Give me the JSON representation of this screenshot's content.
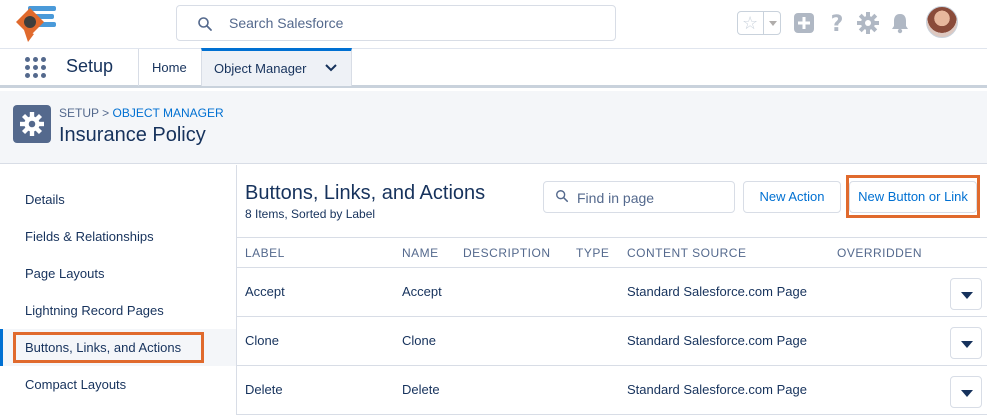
{
  "header": {
    "search_placeholder": "Search Salesforce"
  },
  "nav": {
    "app_name": "Setup",
    "home_label": "Home",
    "active_tab_label": "Object Manager"
  },
  "page": {
    "breadcrumb_root": "SETUP",
    "breadcrumb_separator": ">",
    "breadcrumb_link": "OBJECT MANAGER",
    "title": "Insurance Policy"
  },
  "sidebar": {
    "items": [
      {
        "label": "Details"
      },
      {
        "label": "Fields & Relationships"
      },
      {
        "label": "Page Layouts"
      },
      {
        "label": "Lightning Record Pages"
      },
      {
        "label": "Buttons, Links, and Actions"
      },
      {
        "label": "Compact Layouts"
      }
    ],
    "active_index": 4
  },
  "main": {
    "title": "Buttons, Links, and Actions",
    "subtitle": "8 Items, Sorted by Label",
    "find_placeholder": "Find in page",
    "new_action_label": "New Action",
    "new_button_label": "New Button or Link",
    "columns": [
      "LABEL",
      "NAME",
      "DESCRIPTION",
      "TYPE",
      "CONTENT SOURCE",
      "OVERRIDDEN"
    ],
    "rows": [
      {
        "label": "Accept",
        "name": "Accept",
        "description": "",
        "type": "",
        "content_source": "Standard Salesforce.com Page",
        "overridden": ""
      },
      {
        "label": "Clone",
        "name": "Clone",
        "description": "",
        "type": "",
        "content_source": "Standard Salesforce.com Page",
        "overridden": ""
      },
      {
        "label": "Delete",
        "name": "Delete",
        "description": "",
        "type": "",
        "content_source": "Standard Salesforce.com Page",
        "overridden": ""
      }
    ]
  },
  "colors": {
    "brand_blue": "#0070d2",
    "text_dark": "#16325c",
    "text_muted": "#54698d",
    "highlight_orange": "#e06a2d",
    "logo_orange": "#e06a2d",
    "logo_dark": "#3e3e3c",
    "logo_blue": "#4a9ad9"
  },
  "icons": {
    "logo": "company-logo",
    "search": "search-icon",
    "favorites": "star-icon",
    "add": "plus-icon",
    "help": "question-icon",
    "setup": "gear-icon",
    "notifications": "bell-icon",
    "app_launcher": "waffle-icon",
    "object": "gear-icon"
  }
}
